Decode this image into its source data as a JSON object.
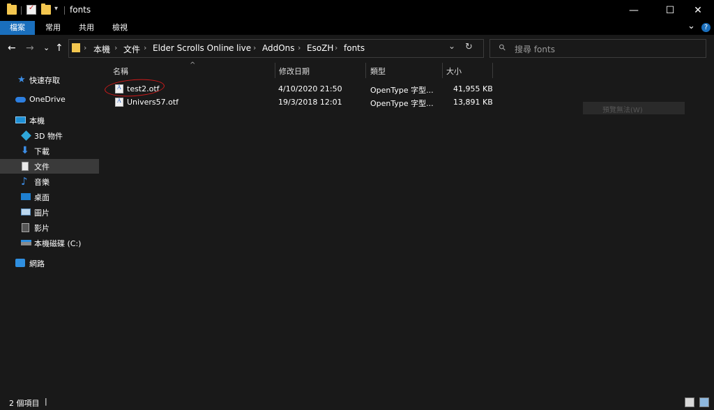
{
  "window": {
    "title": "fonts",
    "min_glyph": "—",
    "max_glyph": "☐",
    "close_glyph": "✕"
  },
  "ribbon": {
    "tabs": [
      "檔案",
      "常用",
      "共用",
      "檢視"
    ],
    "expand_glyph": "⌄",
    "help_glyph": "?"
  },
  "nav": {
    "back": "←",
    "forward": "→",
    "recent": "⌄",
    "up": "↑"
  },
  "address": {
    "crumbs": [
      "本機",
      "文件",
      "Elder Scrolls Online",
      "live",
      "AddOns",
      "EsoZH",
      "fonts"
    ],
    "separator": "›",
    "dropdown_glyph": "⌄",
    "refresh_glyph": "↻"
  },
  "search": {
    "placeholder": "搜尋 fonts",
    "icon_glyph": "⚲"
  },
  "sidebar": {
    "items": [
      {
        "label": "快速存取",
        "icon": "star-icon"
      },
      {
        "label": "OneDrive",
        "icon": "cloud-icon"
      },
      {
        "label": "本機",
        "icon": "computer-icon"
      },
      {
        "label": "3D 物件",
        "icon": "cube-icon"
      },
      {
        "label": "下載",
        "icon": "download-icon"
      },
      {
        "label": "文件",
        "icon": "document-icon"
      },
      {
        "label": "音樂",
        "icon": "music-icon"
      },
      {
        "label": "桌面",
        "icon": "desktop-icon"
      },
      {
        "label": "圖片",
        "icon": "picture-icon"
      },
      {
        "label": "影片",
        "icon": "video-icon"
      },
      {
        "label": "本機磁碟 (C:)",
        "icon": "drive-icon"
      },
      {
        "label": "網路",
        "icon": "network-icon"
      }
    ],
    "selected": "文件"
  },
  "columns": {
    "name": "名稱",
    "date": "修改日期",
    "type": "類型",
    "size": "大小",
    "sort_glyph": "^"
  },
  "files": [
    {
      "name": "test2.otf",
      "date": "4/10/2020 21:50",
      "type": "OpenType 字型...",
      "size": "41,955 KB"
    },
    {
      "name": "Univers57.otf",
      "date": "19/3/2018 12:01",
      "type": "OpenType 字型...",
      "size": "13,891 KB"
    }
  ],
  "preview": {
    "text": "預覽無法(W)"
  },
  "status": {
    "item_count": "2 個項目",
    "cursor": "|"
  },
  "colors": {
    "accent": "#1a6fbd",
    "annotation": "#d11a1a",
    "background": "#191919"
  }
}
